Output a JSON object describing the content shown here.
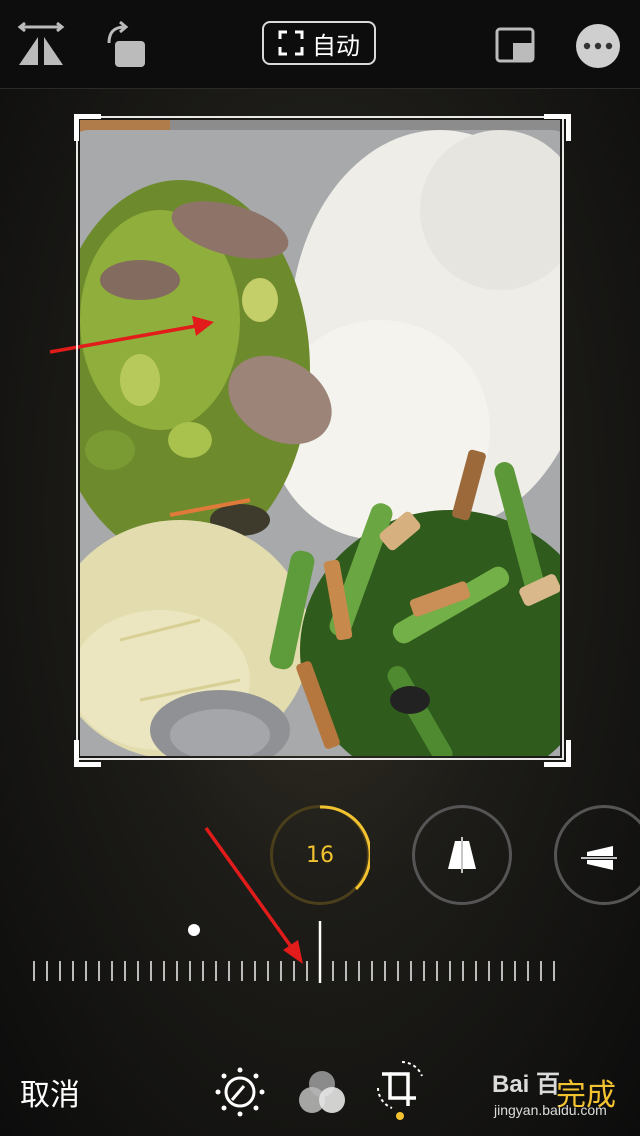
{
  "header": {
    "auto_label": "自动"
  },
  "dials": {
    "straighten_value": "16"
  },
  "footer": {
    "cancel_label": "取消",
    "done_label": "完成"
  },
  "watermark": {
    "logo_text": "Bai 百",
    "url_text": "jingyan.baidu.com"
  },
  "colors": {
    "accent": "#f2c230",
    "annotation_arrow": "#e21b1b"
  },
  "icons": {
    "top_left": [
      "flip-icon",
      "rotate-icon"
    ],
    "top_right": [
      "aspect-ratio-icon",
      "more-icon"
    ],
    "tabs": [
      "adjust-icon",
      "filters-icon",
      "crop-icon"
    ]
  }
}
